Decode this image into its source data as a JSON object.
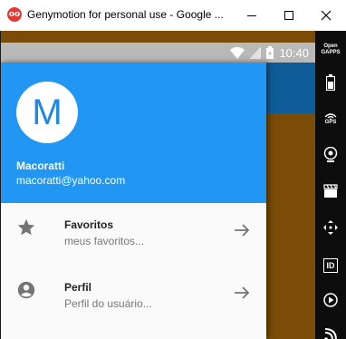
{
  "window": {
    "title": "Genymotion for personal use - Google ...",
    "app_icon_glyph": "oo"
  },
  "statusbar": {
    "time": "10:40"
  },
  "drawer": {
    "avatar_letter": "M",
    "user_name": "Macoratti",
    "user_email": "macoratti@yahoo.com",
    "items": [
      {
        "title": "Favoritos",
        "subtitle": "meus favoritos...",
        "icon": "star-icon"
      },
      {
        "title": "Perfil",
        "subtitle": "Perfil do usuário...",
        "icon": "account-circle-icon"
      }
    ]
  },
  "toolbar": {
    "open_gapps": "Open GAPPS",
    "gps": "GPS",
    "id_label": "ID"
  },
  "colors": {
    "drawer_header": "#2196f3",
    "app_bar": "#0f5c99",
    "background_content": "#7a4c08",
    "status_bar": "#b9b9b9"
  }
}
